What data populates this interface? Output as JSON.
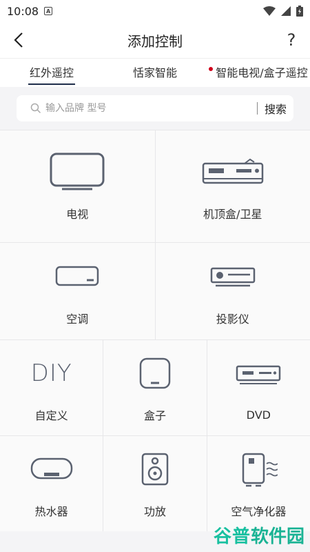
{
  "status": {
    "time": "10:08"
  },
  "header": {
    "title": "添加控制",
    "help": "?"
  },
  "tabs": [
    {
      "label": "红外遥控",
      "active": true
    },
    {
      "label": "恬家智能",
      "active": false
    },
    {
      "label": "智能电视/盒子遥控",
      "active": false,
      "badge": true
    }
  ],
  "search": {
    "placeholder": "输入品牌 型号",
    "button": "搜索"
  },
  "devices": {
    "tv": "电视",
    "stb": "机顶盒/卫星",
    "ac": "空调",
    "projector": "投影仪",
    "custom": "自定义",
    "custom_icon_text": "DIY",
    "box": "盒子",
    "dvd": "DVD",
    "heater": "热水器",
    "amp": "功放",
    "purifier": "空气净化器"
  },
  "watermark": {
    "main": "谷普",
    "sub": "软件园"
  },
  "colors": {
    "icon": "#5b6270",
    "accent": "#1f2d4a",
    "badge": "#d0021b",
    "watermark": "#18c0a0"
  }
}
